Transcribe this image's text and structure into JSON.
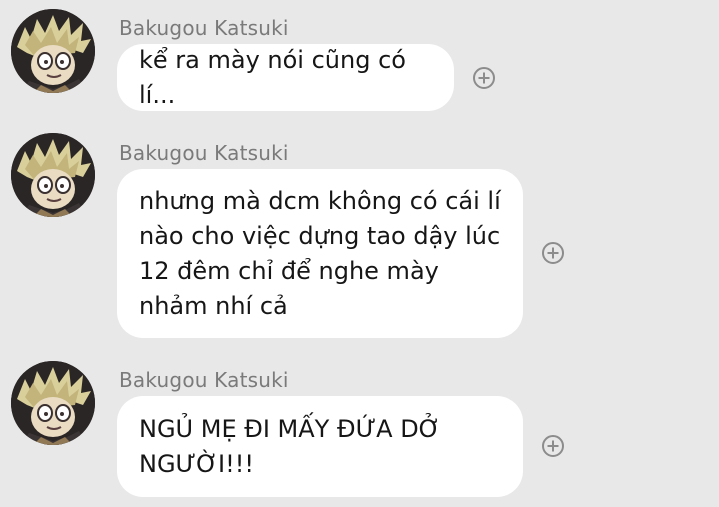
{
  "messages": [
    {
      "sender": "Bakugou Katsuki",
      "text": "kể ra mày nói cũng có lí..."
    },
    {
      "sender": "Bakugou Katsuki",
      "text": "nhưng mà dcm không có cái lí nào cho việc dựng tao dậy lúc 12 đêm chỉ để nghe mày nhảm nhí cả"
    },
    {
      "sender": "Bakugou Katsuki",
      "text": "NGỦ MẸ ĐI MẤY ĐỨA DỞ NGƯỜI!!!"
    }
  ],
  "icons": {
    "avatar": "avatar-image",
    "reaction": "add-reaction-icon"
  },
  "colors": {
    "background": "#e8e8e8",
    "bubble": "#ffffff",
    "sender_name": "#7a7a7a",
    "message_text": "#161616",
    "icon": "#8c8c8c"
  }
}
